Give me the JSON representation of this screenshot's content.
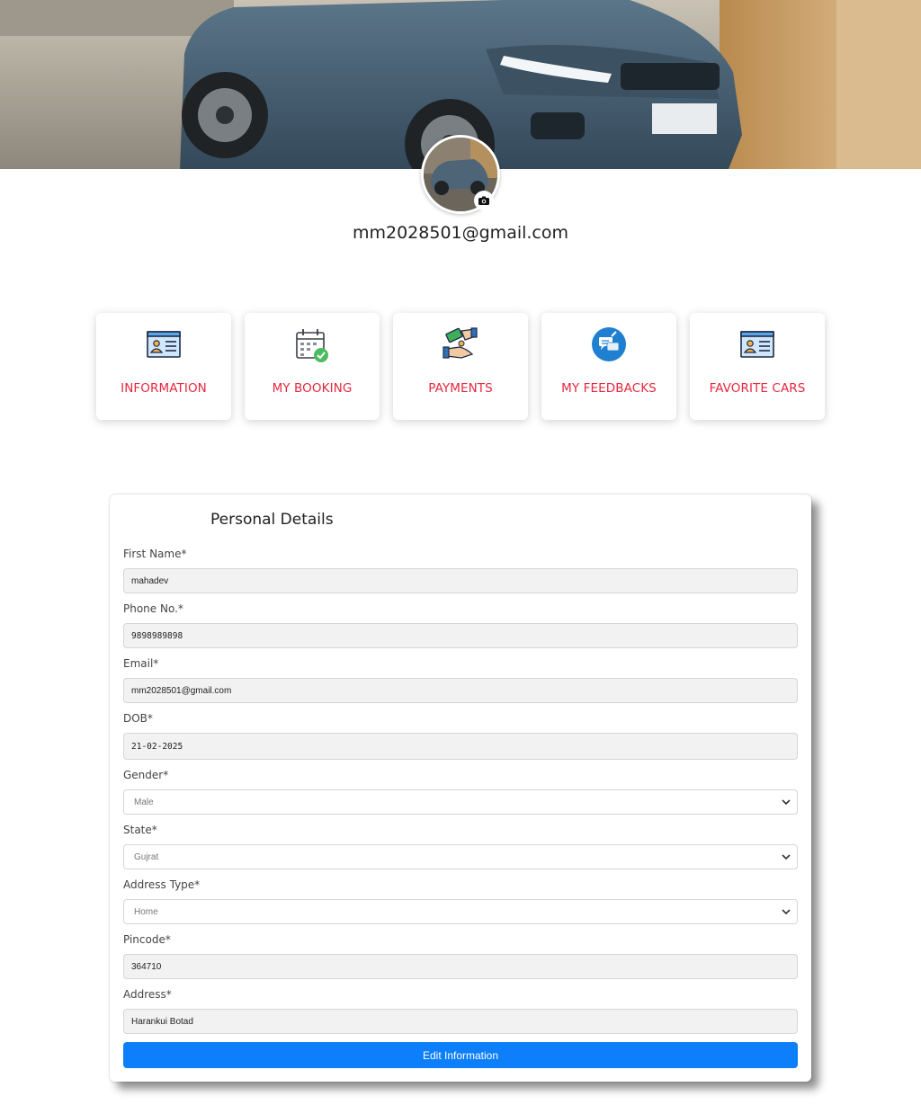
{
  "profile": {
    "email": "mm2028501@gmail.com"
  },
  "menu": {
    "items": [
      {
        "label": "INFORMATION",
        "icon": "id-card-icon"
      },
      {
        "label": "MY BOOKING",
        "icon": "calendar-check-icon"
      },
      {
        "label": "PAYMENTS",
        "icon": "money-hand-icon"
      },
      {
        "label": "MY FEEDBACKS",
        "icon": "feedback-chat-icon"
      },
      {
        "label": "FAVORITE CARS",
        "icon": "id-card-icon"
      }
    ]
  },
  "form": {
    "title": "Personal Details",
    "fields": [
      {
        "label": "First Name*",
        "value": "mahadev"
      },
      {
        "label": "Phone No.*",
        "value": "9898989898"
      },
      {
        "label": "Email*",
        "value": "mm2028501@gmail.com"
      },
      {
        "label": "DOB*",
        "value": "21-02-2025"
      },
      {
        "label": "Gender*",
        "value": "Male"
      },
      {
        "label": "State*",
        "value": "Gujrat"
      },
      {
        "label": "Address Type*",
        "value": "Home"
      },
      {
        "label": "Pincode*",
        "value": "364710"
      },
      {
        "label": "Address*",
        "value": "Harankui Botad"
      }
    ],
    "submit_label": "Edit Information"
  },
  "colors": {
    "accent_red": "#e6273e",
    "button_blue": "#0d7ffb"
  }
}
